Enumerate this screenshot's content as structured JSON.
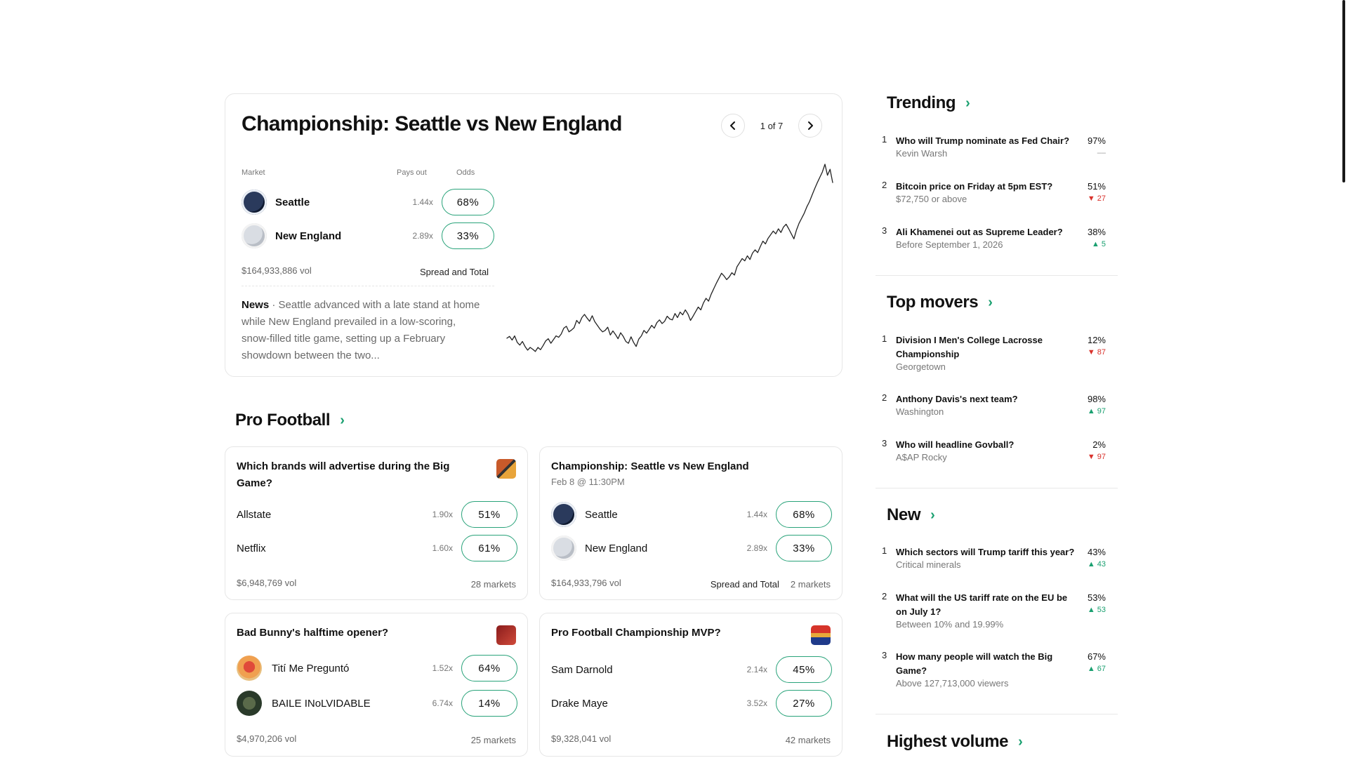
{
  "hero": {
    "title": "Championship: Seattle vs New England",
    "pager": "1 of 7",
    "head_market": "Market",
    "head_pays": "Pays out",
    "head_odds": "Odds",
    "teams": [
      {
        "name": "Seattle",
        "payout": "1.44x",
        "odds": "68%"
      },
      {
        "name": "New England",
        "payout": "2.89x",
        "odds": "33%"
      }
    ],
    "volume": "$164,933,886 vol",
    "spread_link": "Spread and Total",
    "news_label": "News",
    "news_text": "· Seattle advanced with a late stand at home while New England prevailed in a low-scoring, snow-filled title game, setting up a February showdown between the two..."
  },
  "chart_data": {
    "type": "line",
    "series": [
      {
        "values": [
          40,
          44,
          36,
          45,
          31,
          25,
          33,
          22,
          14,
          20,
          16,
          11,
          20,
          15,
          24,
          34,
          39,
          29,
          37,
          45,
          42,
          49,
          62,
          66,
          54,
          58,
          63,
          79,
          72,
          85,
          92,
          84,
          77,
          89,
          76,
          68,
          60,
          54,
          57,
          64,
          47,
          56,
          48,
          39,
          52,
          44,
          33,
          29,
          43,
          31,
          22,
          38,
          45,
          57,
          51,
          59,
          68,
          62,
          74,
          80,
          72,
          77,
          88,
          82,
          80,
          94,
          85,
          97,
          91,
          102,
          93,
          79,
          88,
          98,
          108,
          102,
          117,
          127,
          121,
          136,
          148,
          160,
          171,
          182,
          176,
          168,
          174,
          183,
          178,
          196,
          205,
          214,
          209,
          220,
          212,
          226,
          233,
          227,
          240,
          252,
          246,
          258,
          266,
          274,
          268,
          279,
          271,
          283,
          289,
          279,
          268,
          257,
          276,
          291,
          302,
          313,
          327,
          338,
          352,
          366,
          379,
          391,
          403,
          420,
          396,
          409,
          380
        ]
      }
    ],
    "ylim": [
      0,
      420
    ],
    "grid": false
  },
  "pro_football": {
    "title": "Pro Football",
    "cards": [
      {
        "title": "Which brands will advertise during the Big Game?",
        "rows": [
          {
            "name": "Allstate",
            "payout": "1.90x",
            "odds": "51%"
          },
          {
            "name": "Netflix",
            "payout": "1.60x",
            "odds": "61%"
          }
        ],
        "volume": "$6,948,769 vol",
        "markets": "28 markets"
      },
      {
        "title": "Championship: Seattle vs New England",
        "subtitle": "Feb 8 @ 11:30PM",
        "rows": [
          {
            "name": "Seattle",
            "payout": "1.44x",
            "odds": "68%"
          },
          {
            "name": "New England",
            "payout": "2.89x",
            "odds": "33%"
          }
        ],
        "volume": "$164,933,796 vol",
        "spread": "Spread and Total",
        "markets": "2 markets"
      },
      {
        "title": "Bad Bunny's halftime opener?",
        "rows": [
          {
            "name": "Tití Me Preguntó",
            "payout": "1.52x",
            "odds": "64%"
          },
          {
            "name": "BAILE INoLVIDABLE",
            "payout": "6.74x",
            "odds": "14%"
          }
        ],
        "volume": "$4,970,206 vol",
        "markets": "25 markets"
      },
      {
        "title": "Pro Football Championship MVP?",
        "rows": [
          {
            "name": "Sam Darnold",
            "payout": "2.14x",
            "odds": "45%"
          },
          {
            "name": "Drake Maye",
            "payout": "3.52x",
            "odds": "27%"
          }
        ],
        "volume": "$9,328,041 vol",
        "markets": "42 markets"
      }
    ]
  },
  "sidebar": {
    "trending": {
      "title": "Trending",
      "items": [
        {
          "idx": "1",
          "q": "Who will Trump nominate as Fed Chair?",
          "a": "Kevin Warsh",
          "pct": "97%",
          "chg": "––",
          "dir": "flat"
        },
        {
          "idx": "2",
          "q": "Bitcoin price on Friday at 5pm EST?",
          "a": "$72,750 or above",
          "pct": "51%",
          "chg": "▼ 27",
          "dir": "down"
        },
        {
          "idx": "3",
          "q": "Ali Khamenei out as Supreme Leader?",
          "a": "Before September 1, 2026",
          "pct": "38%",
          "chg": "▲ 5",
          "dir": "up"
        }
      ]
    },
    "top_movers": {
      "title": "Top movers",
      "items": [
        {
          "idx": "1",
          "q": "Division I Men's College Lacrosse Championship",
          "a": "Georgetown",
          "pct": "12%",
          "chg": "▼ 87",
          "dir": "down"
        },
        {
          "idx": "2",
          "q": "Anthony Davis's next team?",
          "a": "Washington",
          "pct": "98%",
          "chg": "▲ 97",
          "dir": "up"
        },
        {
          "idx": "3",
          "q": "Who will headline Govball?",
          "a": "A$AP Rocky",
          "pct": "2%",
          "chg": "▼ 97",
          "dir": "down"
        }
      ]
    },
    "new": {
      "title": "New",
      "items": [
        {
          "idx": "1",
          "q": "Which sectors will Trump tariff this year?",
          "a": "Critical minerals",
          "pct": "43%",
          "chg": "▲ 43",
          "dir": "up"
        },
        {
          "idx": "2",
          "q": "What will the US tariff rate on the EU be on July 1?",
          "a": "Between 10% and 19.99%",
          "pct": "53%",
          "chg": "▲ 53",
          "dir": "up"
        },
        {
          "idx": "3",
          "q": "How many people will watch the Big Game?",
          "a": "Above 127,713,000 viewers",
          "pct": "67%",
          "chg": "▲ 67",
          "dir": "up"
        }
      ]
    },
    "highest_volume": {
      "title": "Highest volume"
    }
  },
  "icons": {
    "prev": "chevron-left-icon",
    "next": "chevron-right-icon",
    "section": "chevron-right-icon"
  },
  "colors": {
    "accent": "#1aa070",
    "odds_border": "#29a37a",
    "down": "#d9322c"
  }
}
